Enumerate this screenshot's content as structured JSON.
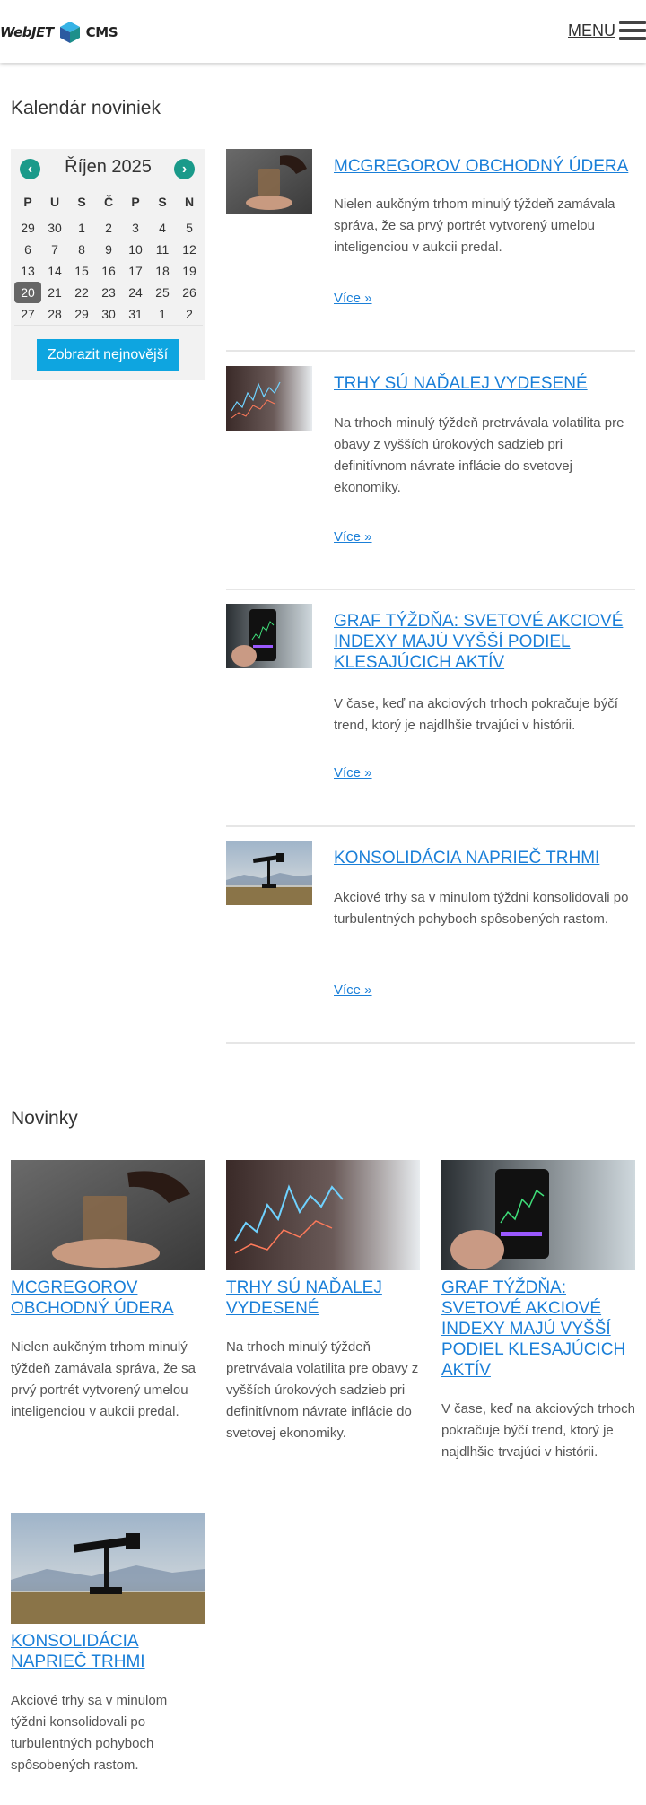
{
  "header": {
    "logo_part1": "WebJET",
    "logo_part2": "CMS",
    "menu_label": "MENU"
  },
  "calendar_section": {
    "heading": "Kalendár noviniek",
    "month_title": "Říjen 2025",
    "prev_icon": "chevron-left-icon",
    "next_icon": "chevron-right-icon",
    "weekdays": [
      "P",
      "U",
      "S",
      "Č",
      "P",
      "S",
      "N"
    ],
    "weeks": [
      [
        "29",
        "30",
        "1",
        "2",
        "3",
        "4",
        "5"
      ],
      [
        "6",
        "7",
        "8",
        "9",
        "10",
        "11",
        "12"
      ],
      [
        "13",
        "14",
        "15",
        "16",
        "17",
        "18",
        "19"
      ],
      [
        "20",
        "21",
        "22",
        "23",
        "24",
        "25",
        "26"
      ],
      [
        "27",
        "28",
        "29",
        "30",
        "31",
        "1",
        "2"
      ]
    ],
    "today": "20",
    "show_latest_button": "Zobrazit nejnovější",
    "accent_color": "#1a9a8a",
    "button_color": "#0ea5e0"
  },
  "news_list": [
    {
      "title": "MCGREGOROV OBCHODNÝ ÚDERA",
      "text": "Nielen aukčným trhom minulý týždeň zamávala správa, že sa prvý portrét vytvorený umelou inteligenciou v aukcii predal.",
      "more": "Více »",
      "image": "whisky-pour-photo"
    },
    {
      "title": "TRHY SÚ NAĎALEJ VYDESENÉ",
      "text": "Na trhoch minulý týždeň pretrvávala volatilita pre obavy z vyšších úrokových sadzieb pri definitívnom návrate inflácie do svetovej ekonomiky.",
      "more": "Více »",
      "image": "stock-chart-photo"
    },
    {
      "title": "GRAF TÝŽDŇA: SVETOVÉ AKCIOVÉ INDEXY MAJÚ VYŠŠÍ PODIEL KLESAJÚCICH AKTÍV",
      "text": "V čase, keď na akciových trhoch pokračuje býčí trend, ktorý je najdlhšie trvajúci v histórii.",
      "more": "Více »",
      "image": "phone-trading-photo"
    },
    {
      "title": "KONSOLIDÁCIA NAPRIEČ TRHMI",
      "text": "Akciové trhy sa v minulom týždni konsolidovali po turbulentných pohyboch spôsobených rastom.",
      "more": "Více »",
      "image": "oil-pump-photo"
    }
  ],
  "novinky": {
    "heading": "Novinky",
    "cards": [
      {
        "title": "MCGREGOROV OBCHODNÝ ÚDERA",
        "text": "Nielen aukčným trhom minulý týždeň zamávala správa, že sa prvý portrét vytvorený umelou inteligenciou v aukcii predal."
      },
      {
        "title": "TRHY SÚ NAĎALEJ VYDESENÉ",
        "text": "Na trhoch minulý týždeň pretrvávala volatilita pre obavy z vyšších úrokových sadzieb pri definitívnom návrate inflácie do svetovej ekonomiky."
      },
      {
        "title": "GRAF TÝŽDŇA: SVETOVÉ AKCIOVÉ INDEXY MAJÚ VYŠŠÍ PODIEL KLESAJÚCICH AKTÍV",
        "text": "V čase, keď na akciových trhoch pokračuje býčí trend, ktorý je najdlhšie trvajúci v histórii."
      },
      {
        "title": "KONSOLIDÁCIA NAPRIEČ TRHMI",
        "text": "Akciové trhy sa v minulom týždni konsolidovali po turbulentných pohyboch spôsobených rastom."
      }
    ]
  },
  "colors": {
    "link": "#1a7fd8",
    "today_bg": "#666666"
  }
}
